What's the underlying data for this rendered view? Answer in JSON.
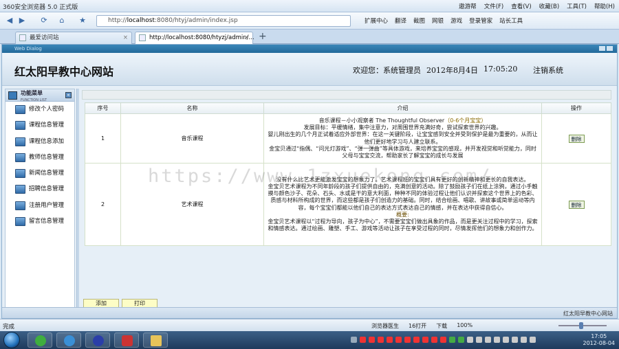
{
  "browser": {
    "app_title": "360安全浏览器 5.0 正式版",
    "menus": [
      "遨游帮",
      "文件(F)",
      "查看(V)",
      "收藏(B)",
      "工具(T)",
      "帮助(H)"
    ],
    "address": {
      "prefix": "http://",
      "host": "localhost",
      "path": ":8080/htyj/admin/index.jsp"
    },
    "toolbar": [
      "扩展中心",
      "翻译",
      "截图",
      "网银",
      "游戏",
      "登录管家",
      "站长工具"
    ],
    "tabs": [
      {
        "label": "最爱访问站"
      },
      {
        "label": "http://localhost:8080/htyzj/admin/..."
      }
    ]
  },
  "frame": {
    "title": "Web Dialog"
  },
  "site": {
    "name": "红太阳早教中心网站",
    "welcome": "欢迎您：系统管理员",
    "date": "2012年8月4日",
    "time": "17:05:20",
    "logout": "注销系统"
  },
  "sidebar": {
    "title": "功能菜单",
    "subtitle": "FUNCTION LIST",
    "toggle": "«",
    "items": [
      {
        "label": "修改个人密码"
      },
      {
        "label": "课程信息管理"
      },
      {
        "label": "课程信息添加"
      },
      {
        "label": "教师信息管理"
      },
      {
        "label": "新闻信息管理"
      },
      {
        "label": "招聘信息管理"
      },
      {
        "label": "注册用户管理"
      },
      {
        "label": "留言信息管理"
      }
    ]
  },
  "table": {
    "headers": [
      "序号",
      "名称",
      "介绍",
      "操作"
    ],
    "rows": [
      {
        "num": "1",
        "name": "音乐课程",
        "desc": [
          {
            "text": "音乐课程－小小观察者  The Thoughtful Observer",
            "tag": "（0-6个月宝宝）"
          },
          {
            "text": "发展目标：平缓情绪，集中注意力，对周围世界充满好奇，尝试探索世界的兴趣。"
          },
          {
            "text": "婴儿刚出生的几个月正试着适应外部世界：在这一关键阶段，让宝宝感到安全并受到保护是最为重要的，从而让他们更好地学习与人建立联系。"
          },
          {
            "text": "金宝贝通过“指偶、“问光灯游戏”、“弹一弹曲”等具体游戏，来培养宝宝的感观，并开发视觉和听觉能力，同时父母与宝宝交流，帮助家长了解宝宝的成长与发展"
          }
        ],
        "op": "删除"
      },
      {
        "num": "2",
        "name": "艺术课程",
        "desc": [
          {
            "text": "没有什么比艺术更能激发宝宝的想象力了。艺术课程班的宝宝们具有更好的创新精神和更长的自我表达。"
          },
          {
            "text": "金宝贝艺术课程为不同年龄段的孩子们提供自由的，充满创意的活动。除了鼓励孩子们在纸上涂鸦，通过小手触摸与颜色沙子、花朵、石头、水或是干的意大利面，种种不同的体验过程让他们认识并探索这个世界上的色彩、质感与材料所构成的世界，而这些都是孩子们创造力的基础。同时，结合绘画、唱歌、讲故事或简单运动等内容，每个宝宝们都能以他们自己的表达方式表达自己的情感，并在表达中获得自信心。"
          },
          {
            "text": "",
            "tag": "概要:"
          },
          {
            "text": "金宝贝艺术课程以“过程为导向，孩子为中心”，不需要宝宝们做出具象的作品，而是更关注过程中的学习，探索和情感表达。通过绘画、雕塑、手工、游戏等活动让孩子在享受过程的同时，尽情发挥他们的想象力和创作力。"
          }
        ],
        "op": "删除"
      }
    ]
  },
  "actions": {
    "add": "添加",
    "print": "打印"
  },
  "footer": {
    "text": "红太阳早教中心网站"
  },
  "watermark": "https://www.1zxuekong.com/",
  "status": {
    "left": "完成",
    "items": [
      "浏览器医生",
      "16打开",
      "下载",
      "100%"
    ]
  },
  "clock": {
    "time": "17:05",
    "date": "2012-08-04"
  }
}
